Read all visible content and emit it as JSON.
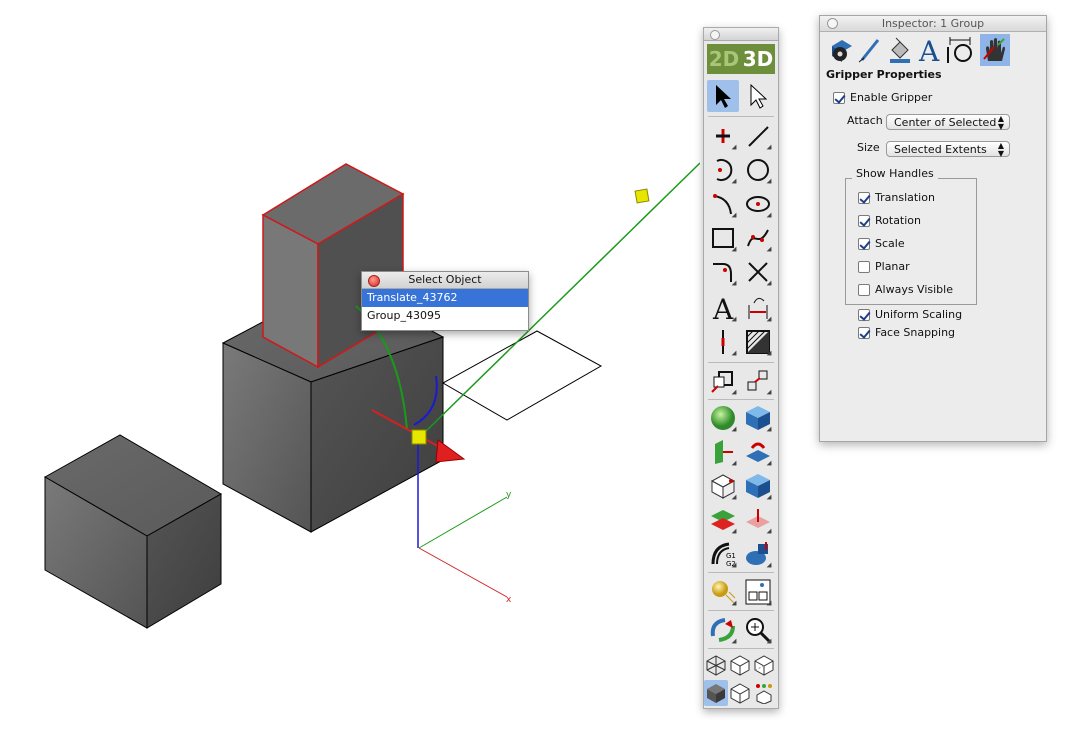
{
  "viewport": {
    "axes": {
      "x_label": "x",
      "y_label": "y"
    }
  },
  "select_object": {
    "title": "Select Object",
    "items": [
      {
        "label": "Translate_43762",
        "selected": true
      },
      {
        "label": "Group_43095",
        "selected": false
      }
    ]
  },
  "toolbar": {
    "mode_2d": "2D",
    "mode_3d": "3D",
    "tools": [
      "select-arrow",
      "direct-select-arrow",
      "point",
      "line",
      "arc",
      "circle",
      "arc-tangent",
      "ellipse",
      "rectangle",
      "spline",
      "fillet",
      "trim",
      "text",
      "dimension",
      "vertical-line",
      "hatch",
      "transform",
      "scale",
      "sphere",
      "solid-cube",
      "extrude",
      "move-solid",
      "box",
      "cutaway",
      "layers",
      "sweep",
      "gradient",
      "boolean",
      "light",
      "layout",
      "rotate-view",
      "zoom",
      "wire-view",
      "hidden-view",
      "hidden-line-view",
      "shaded-view",
      "outline-view",
      "render-options"
    ]
  },
  "inspector": {
    "title": "Inspector:  1 Group",
    "section_title": "Gripper Properties",
    "tabs": [
      "object-settings-icon",
      "pen-icon",
      "paint-icon",
      "text-icon",
      "dimension-icon",
      "gripper-icon"
    ],
    "enable_gripper": {
      "label": "Enable Gripper",
      "checked": true
    },
    "attach": {
      "label": "Attach",
      "value": "Center of Selected"
    },
    "size": {
      "label": "Size",
      "value": "Selected Extents"
    },
    "show_handles": {
      "legend": "Show Handles",
      "items": [
        {
          "label": "Translation",
          "checked": true
        },
        {
          "label": "Rotation",
          "checked": true
        },
        {
          "label": "Scale",
          "checked": true
        },
        {
          "label": "Planar",
          "checked": false
        },
        {
          "label": "Always Visible",
          "checked": false
        }
      ]
    },
    "uniform_scaling": {
      "label": "Uniform Scaling",
      "checked": true
    },
    "face_snapping": {
      "label": "Face Snapping",
      "checked": true
    }
  },
  "colors": {
    "accent_selection": "#3874d8",
    "mode_bar": "#6d8e3a",
    "axis_x": "#d42020",
    "axis_y": "#1a9a1a",
    "axis_z": "#1a1ad0",
    "gripper_handle": "#e6e600"
  }
}
